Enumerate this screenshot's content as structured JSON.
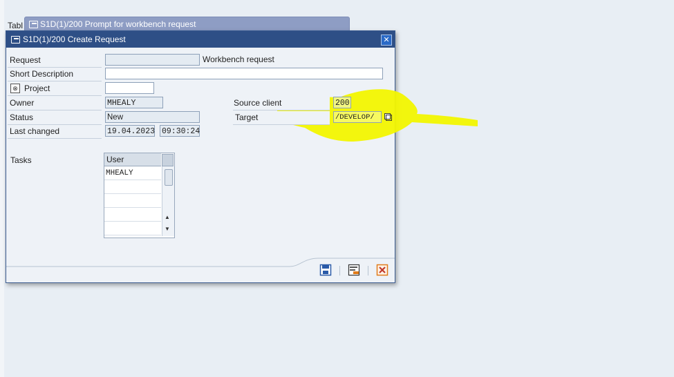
{
  "background": {
    "label": "Tabl"
  },
  "back_dialog": {
    "title": "S1D(1)/200 Prompt for workbench request"
  },
  "dialog": {
    "title": "S1D(1)/200 Create Request",
    "close_label": "✕",
    "fields": {
      "request": {
        "label": "Request",
        "value": "",
        "type_text": "Workbench request"
      },
      "short_description": {
        "label": "Short Description",
        "value": ""
      },
      "project": {
        "label": "Project",
        "value": ""
      },
      "owner": {
        "label": "Owner",
        "value": "MHEALY"
      },
      "status": {
        "label": "Status",
        "value": "New"
      },
      "last_changed": {
        "label": "Last changed",
        "date": "19.04.2023",
        "time": "09:30:24"
      },
      "source_client": {
        "label": "Source client",
        "value": "200"
      },
      "target": {
        "label": "Target",
        "value": "/DEVELOP/"
      }
    },
    "tasks": {
      "label": "Tasks",
      "column": "User",
      "rows": [
        "MHEALY",
        "",
        "",
        "",
        ""
      ]
    },
    "toolbar": [
      "save-icon",
      "choose-icon",
      "cancel-icon"
    ]
  },
  "colors": {
    "titlebar": "#2e4f86",
    "back_titlebar": "#8e9dc4",
    "highlight": "#f2f500",
    "cancel": "#e07b1a"
  }
}
